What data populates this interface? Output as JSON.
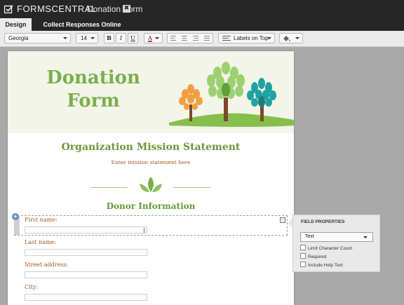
{
  "app": {
    "name": "FORMSCENTRAL",
    "form_tab": "Donation Form",
    "close_glyph": "✖"
  },
  "tabs": [
    {
      "label": "Design",
      "active": true
    },
    {
      "label": "Collect Responses Online",
      "active": false
    }
  ],
  "toolbar": {
    "font": "Georgia",
    "size": "14",
    "bold": "B",
    "italic": "I",
    "underline": "U",
    "text_color": "A",
    "labels_position": "Labels on Top"
  },
  "form": {
    "banner_title": "Donation Form",
    "mission_heading": "Organization Mission Statement",
    "mission_text": "Enter mission statement here",
    "donor_heading": "Donor Information",
    "fields": [
      {
        "label": "First name:"
      },
      {
        "label": "Last name:"
      },
      {
        "label": "Street address:"
      },
      {
        "label": "City:"
      }
    ]
  },
  "field_properties": {
    "title": "FIELD PROPERTIES",
    "type": "Text",
    "options": [
      "Limit Character Count",
      "Required",
      "Include Help Text"
    ]
  },
  "colors": {
    "title_green": "#7ab04a",
    "label_brown": "#a05a2a",
    "banner_bg": "#f3f5e9"
  }
}
